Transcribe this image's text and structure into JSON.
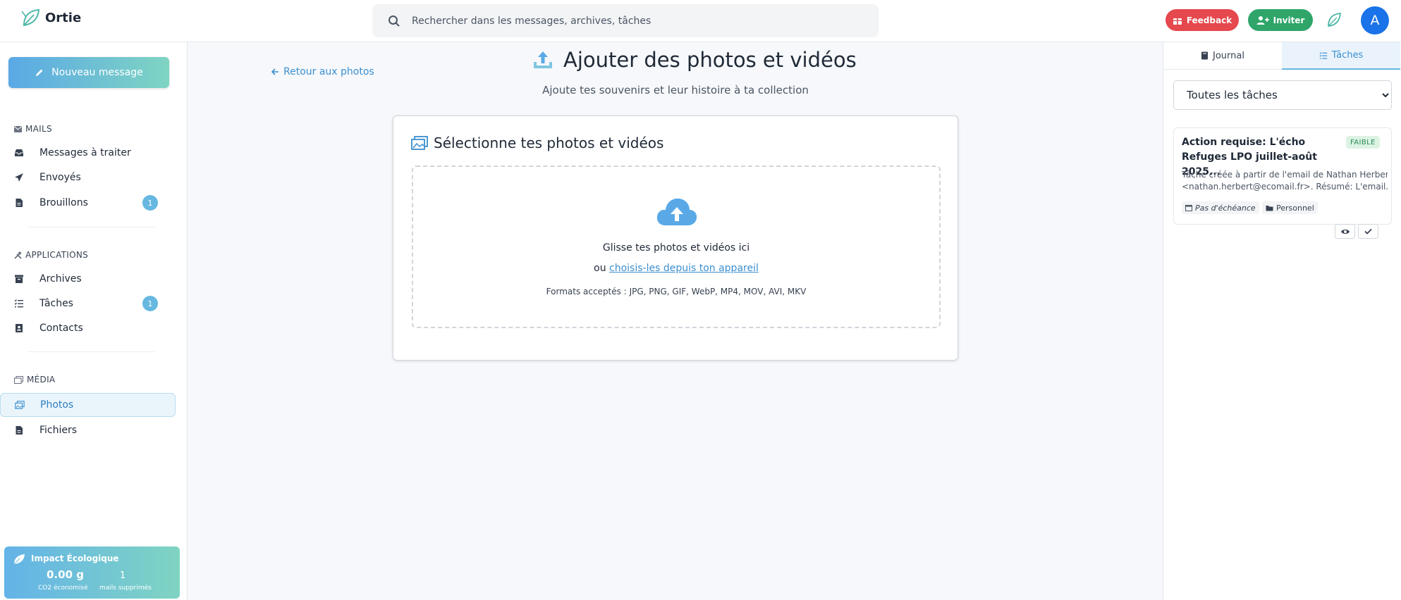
{
  "app": {
    "name": "Ortie"
  },
  "search": {
    "placeholder": "Rechercher dans les messages, archives, tâches"
  },
  "header": {
    "feedback_label": "Feedback",
    "invite_label": "Inviter",
    "avatar_initial": "A"
  },
  "sidebar": {
    "new_message_label": "Nouveau message",
    "sections": {
      "mails": "MAILS",
      "applications": "APPLICATIONS",
      "media": "MÉDIA"
    },
    "items": {
      "inbox": "Messages à traiter",
      "sent": "Envoyés",
      "drafts": "Brouillons",
      "drafts_count": "1",
      "archives": "Archives",
      "tasks": "Tâches",
      "tasks_count": "1",
      "contacts": "Contacts",
      "photos": "Photos",
      "files": "Fichiers"
    },
    "impact": {
      "title": "Impact Écologique",
      "co2_value": "0.00 g",
      "co2_label": "CO2 économisé",
      "mails_value": "1",
      "mails_label": "mails supprimés"
    }
  },
  "main": {
    "back_label": "Retour aux photos",
    "title": "Ajouter des photos et vidéos",
    "subtitle": "Ajoute tes souvenirs et leur histoire à ta collection",
    "card_title": "Sélectionne tes photos et vidéos",
    "dropzone": {
      "main": "Glisse tes photos et vidéos ici",
      "or_prefix": "ou ",
      "choose_link": "choisis-les depuis ton appareil",
      "formats": "Formats acceptés : JPG, PNG, GIF, WebP, MP4, MOV, AVI, MKV"
    }
  },
  "right_panel": {
    "tabs": {
      "journal": "Journal",
      "tasks": "Tâches"
    },
    "filter_selected": "Toutes les tâches",
    "task": {
      "title": "Action requise: L'écho Refuges LPO juillet-août 2025...",
      "priority": "FAIBLE",
      "description_line1": "Tâche créée à partir de l'email de Nathan Herbert",
      "description_line2": "<nathan.herbert@ecomail.fr>. Résumé: L'email...",
      "due": "Pas d'échéance",
      "category": "Personnel"
    }
  },
  "colors": {
    "accent": "#3b8fd0",
    "feedback": "#e5484d",
    "invite": "#2fa56a",
    "avatar": "#1a73e8",
    "priority_low": "#2a8a55"
  }
}
